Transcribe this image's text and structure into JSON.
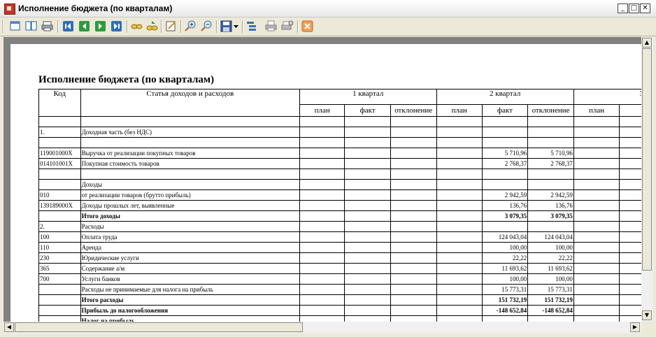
{
  "window": {
    "title": "Исполнение бюджета (по кварталам)",
    "controls": {
      "minimize": "_",
      "maximize": "□",
      "close": "✕"
    }
  },
  "toolbar": {
    "buttons": [
      {
        "icon": "page-view-icon"
      },
      {
        "icon": "two-page-view-icon"
      },
      {
        "icon": "print-preview-icon"
      },
      {
        "icon": "first-page-icon"
      },
      {
        "icon": "previous-page-icon"
      },
      {
        "icon": "next-page-icon"
      },
      {
        "icon": "last-page-icon"
      },
      {
        "icon": "find-icon"
      },
      {
        "icon": "find-next-icon"
      },
      {
        "icon": "edit-icon"
      },
      {
        "icon": "zoom-in-icon"
      },
      {
        "icon": "zoom-out-icon"
      },
      {
        "icon": "save-icon"
      },
      {
        "icon": "save-dropdown-icon"
      },
      {
        "icon": "outline-icon"
      },
      {
        "icon": "print-icon"
      },
      {
        "icon": "print-setup-icon"
      },
      {
        "icon": "close-preview-icon"
      }
    ]
  },
  "report": {
    "title": "Исполнение бюджета (по кварталам)",
    "headers": {
      "code": "Код",
      "article": "Статья доходов и расходов",
      "q1": "1 квартал",
      "q2": "2 квартал",
      "q3": "3",
      "plan": "план",
      "fact": "факт",
      "deviation": "отклонение"
    },
    "rows": [
      {
        "code": "",
        "name": "",
        "q2_fact": "",
        "q2_dev": "",
        "bold": false
      },
      {
        "code": "1.",
        "name": "Доходная часть (без НДС)",
        "q2_fact": "",
        "q2_dev": "",
        "bold": false
      },
      {
        "code": "",
        "name": "",
        "q2_fact": "",
        "q2_dev": "",
        "bold": false
      },
      {
        "code": "119001000X",
        "name": "Выручка от реализации покупных товаров",
        "q2_fact": "5 710,96",
        "q2_dev": "5 710,96",
        "bold": false
      },
      {
        "code": "014101001X",
        "name": "Покупная стоимость товаров",
        "q2_fact": "2 768,37",
        "q2_dev": "2 768,37",
        "bold": false
      },
      {
        "code": "",
        "name": "",
        "q2_fact": "",
        "q2_dev": "",
        "bold": false
      },
      {
        "code": "",
        "name": "Доходы",
        "q2_fact": "",
        "q2_dev": "",
        "bold": false
      },
      {
        "code": "010",
        "name": "от реализации товаров (брутто прибыль)",
        "q2_fact": "2 942,59",
        "q2_dev": "2 942,59",
        "bold": false
      },
      {
        "code": "139189000X",
        "name": "Доходы прошлых лет, выявленные",
        "q2_fact": "136,76",
        "q2_dev": "136,76",
        "bold": false
      },
      {
        "code": "",
        "name": "Итого доходы",
        "q2_fact": "3 079,35",
        "q2_dev": "3 079,35",
        "bold": true
      },
      {
        "code": "2.",
        "name": "Расходы",
        "q2_fact": "",
        "q2_dev": "",
        "bold": false
      },
      {
        "code": "100",
        "name": "Оплата труда",
        "q2_fact": "124 043,04",
        "q2_dev": "124 043,04",
        "bold": false
      },
      {
        "code": "110",
        "name": "Аренда",
        "q2_fact": "100,00",
        "q2_dev": "100,00",
        "bold": false
      },
      {
        "code": "230",
        "name": "Юридические услуги",
        "q2_fact": "22,22",
        "q2_dev": "22,22",
        "bold": false
      },
      {
        "code": "365",
        "name": "Содержание а/м",
        "q2_fact": "11 693,62",
        "q2_dev": "11 693,62",
        "bold": false
      },
      {
        "code": "700",
        "name": "Услуги банков",
        "q2_fact": "100,00",
        "q2_dev": "100,00",
        "bold": false
      },
      {
        "code": "",
        "name": "Расходы не принимаемые для налога на прибыль",
        "q2_fact": "15 773,31",
        "q2_dev": "15 773,31",
        "bold": false
      },
      {
        "code": "",
        "name": "Итого расходы",
        "q2_fact": "151 732,19",
        "q2_dev": "151 732,19",
        "bold": true
      },
      {
        "code": "",
        "name": "Прибыль до налогообложения",
        "q2_fact": "-148 652,84",
        "q2_dev": "-148 652,84",
        "bold": true
      },
      {
        "code": "",
        "name": "Налог на прибыль",
        "q2_fact": "",
        "q2_dev": "",
        "bold": true
      }
    ]
  },
  "scrollbars": {
    "up": "▲",
    "down": "▼",
    "left": "◀",
    "right": "▶"
  },
  "colors": {
    "accent": "#c0392b",
    "toolbar": "#ece9d8",
    "page": "#ffffff",
    "desk": "#808080"
  }
}
